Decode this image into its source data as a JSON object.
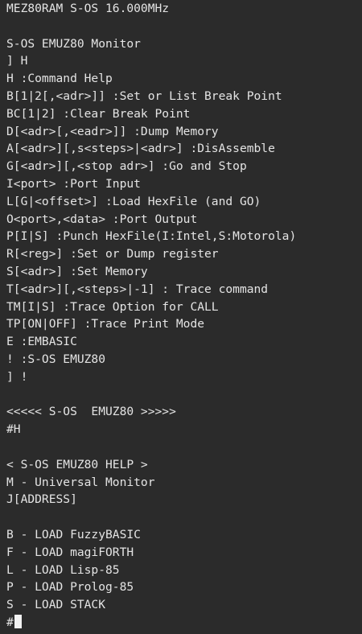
{
  "terminal": {
    "lines": [
      "MEZ80RAM S-OS 16.000MHz",
      "",
      "S-OS EMUZ80 Monitor",
      "] H",
      "H :Command Help",
      "B[1|2[,<adr>]] :Set or List Break Point",
      "BC[1|2] :Clear Break Point",
      "D[<adr>[,<eadr>]] :Dump Memory",
      "A[<adr>][,s<steps>|<adr>] :DisAssemble",
      "G[<adr>][,<stop adr>] :Go and Stop",
      "I<port> :Port Input",
      "L[G|<offset>] :Load HexFile (and GO)",
      "O<port>,<data> :Port Output",
      "P[I|S] :Punch HexFile(I:Intel,S:Motorola)",
      "R[<reg>] :Set or Dump register",
      "S[<adr>] :Set Memory",
      "T[<adr>][,<steps>|-1] : Trace command",
      "TM[I|S] :Trace Option for CALL",
      "TP[ON|OFF] :Trace Print Mode",
      "E :EMBASIC",
      "! :S-OS EMUZ80",
      "] !",
      "",
      "<<<<< S-OS  EMUZ80 >>>>>",
      "#H",
      "",
      "< S-OS EMUZ80 HELP >",
      "M - Universal Monitor",
      "J[ADDRESS]",
      "",
      "B - LOAD FuzzyBASIC",
      "F - LOAD magiFORTH",
      "L - LOAD Lisp-85",
      "P - LOAD Prolog-85",
      "S - LOAD STACK"
    ],
    "prompt": "#",
    "colors": {
      "background": "#2b2b2b",
      "foreground": "#e4e4e4",
      "cursor": "#f2f2f2"
    }
  }
}
